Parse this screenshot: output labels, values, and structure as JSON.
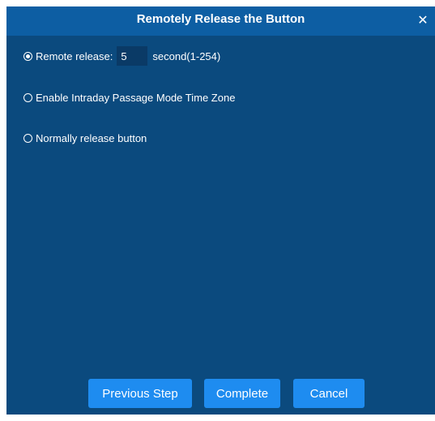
{
  "dialog": {
    "title": "Remotely Release the Button",
    "close_icon": "close-icon"
  },
  "options": [
    {
      "label": "Remote release:",
      "selected": true,
      "input_value": "5",
      "unit_label": "second(1-254)"
    },
    {
      "label": "Enable Intraday Passage Mode Time Zone",
      "selected": false
    },
    {
      "label": "Normally release button",
      "selected": false
    }
  ],
  "buttons": {
    "previous_label": "Previous Step",
    "complete_label": "Complete",
    "cancel_label": "Cancel"
  },
  "colors": {
    "panel_background": "#0b4a7e",
    "titlebar_background": "#0d5ea3",
    "button_background": "#1e8cf0",
    "input_background": "#0a3a66",
    "text": "#ffffff"
  }
}
